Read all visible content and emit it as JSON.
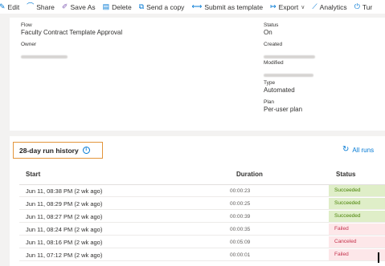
{
  "toolbar": {
    "items": [
      {
        "label": "Edit",
        "icon": "pencil-icon"
      },
      {
        "label": "Share",
        "icon": "share-icon"
      },
      {
        "label": "Save As",
        "icon": "save-as-icon"
      },
      {
        "label": "Delete",
        "icon": "delete-icon"
      },
      {
        "label": "Send a copy",
        "icon": "send-copy-icon"
      },
      {
        "label": "Submit as template",
        "icon": "submit-template-icon"
      },
      {
        "label": "Export",
        "icon": "export-icon"
      },
      {
        "label": "Analytics",
        "icon": "analytics-icon"
      },
      {
        "label": "Tur",
        "icon": "power-icon"
      }
    ]
  },
  "details": {
    "flow_label": "Flow",
    "flow_value": "Faculty Contract Template Approval",
    "owner_label": "Owner",
    "status_label": "Status",
    "status_value": "On",
    "created_label": "Created",
    "modified_label": "Modified",
    "type_label": "Type",
    "type_value": "Automated",
    "plan_label": "Plan",
    "plan_value": "Per-user plan"
  },
  "history": {
    "title": "28-day run history",
    "all_runs": "All runs",
    "columns": {
      "start": "Start",
      "duration": "Duration",
      "status": "Status"
    },
    "rows": [
      {
        "start": "Jun 11, 08:38 PM (2 wk ago)",
        "duration": "00:00:23",
        "status": "Succeeded",
        "kind": "ok"
      },
      {
        "start": "Jun 11, 08:29 PM (2 wk ago)",
        "duration": "00:00:25",
        "status": "Succeeded",
        "kind": "ok"
      },
      {
        "start": "Jun 11, 08:27 PM (2 wk ago)",
        "duration": "00:00:39",
        "status": "Succeeded",
        "kind": "ok"
      },
      {
        "start": "Jun 11, 08:24 PM (2 wk ago)",
        "duration": "00:00:35",
        "status": "Failed",
        "kind": "fail"
      },
      {
        "start": "Jun 11, 08:16 PM (2 wk ago)",
        "duration": "00:05:09",
        "status": "Canceled",
        "kind": "cancel"
      },
      {
        "start": "Jun 11, 07:12 PM (2 wk ago)",
        "duration": "00:00:01",
        "status": "Failed",
        "kind": "fail"
      }
    ]
  },
  "colors": {
    "accent": "#0078d4",
    "highlight": "#e3953b",
    "success_bg": "#dfeec8",
    "fail_bg": "#fde7e9"
  }
}
